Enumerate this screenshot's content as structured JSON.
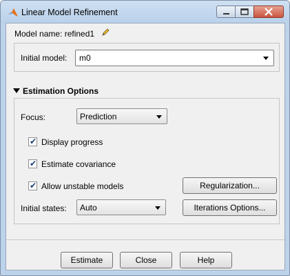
{
  "window": {
    "title": "Linear Model Refinement"
  },
  "model": {
    "name_label": "Model name: refined1"
  },
  "initial_model": {
    "label": "Initial model:",
    "value": "m0"
  },
  "estimation_options": {
    "heading": "Estimation Options",
    "focus": {
      "label": "Focus:",
      "value": "Prediction"
    },
    "display_progress": {
      "label": "Display progress",
      "checked": true
    },
    "estimate_covariance": {
      "label": "Estimate covariance",
      "checked": true
    },
    "allow_unstable": {
      "label": "Allow unstable models",
      "checked": true
    },
    "regularization_button": "Regularization...",
    "iterations_button": "Iterations Options...",
    "initial_states": {
      "label": "Initial states:",
      "value": "Auto"
    }
  },
  "footer": {
    "estimate": "Estimate",
    "close": "Close",
    "help": "Help"
  },
  "icons": {
    "app": "matlab-logo-icon",
    "edit": "pencil-icon",
    "check": "✔"
  }
}
